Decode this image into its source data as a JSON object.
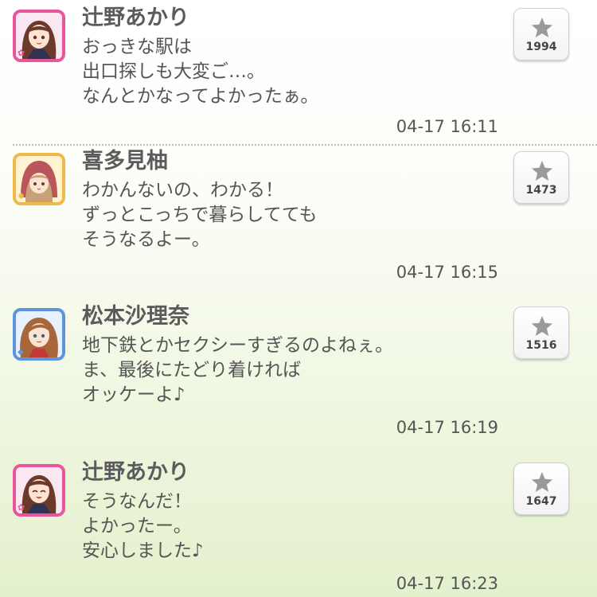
{
  "posts": [
    {
      "name": "辻野あかり",
      "lines": [
        "おっきな駅は",
        "出口探しも大変ご…。",
        "なんとかなってよかったぁ。"
      ],
      "time": "04-17 16:11",
      "likes": "1994",
      "avatar_color": "#e8559b",
      "icon": "pink-flower-icon"
    },
    {
      "name": "喜多見柚",
      "lines": [
        "わかんないの、わかる！",
        "ずっとこっちで暮らしてても",
        "そうなるよー。"
      ],
      "time": "04-17 16:15",
      "likes": "1473",
      "avatar_color": "#f1b94a",
      "icon": "yellow-sun-icon"
    },
    {
      "name": "松本沙理奈",
      "lines": [
        "地下鉄とかセクシーすぎるのよねぇ。",
        "ま、最後にたどり着ければ",
        "オッケーよ♪"
      ],
      "time": "04-17 16:19",
      "likes": "1516",
      "avatar_color": "#5d95dd",
      "icon": "blue-diamond-icon"
    },
    {
      "name": "辻野あかり",
      "lines": [
        "そうなんだ！",
        "よかったー。",
        "安心しました♪"
      ],
      "time": "04-17 16:23",
      "likes": "1647",
      "avatar_color": "#e8559b",
      "icon": "pink-flower-icon"
    }
  ],
  "colors": {
    "name_text": "#5b5b5b",
    "body_text": "#555555",
    "star_icon": "#9a9a9a"
  }
}
